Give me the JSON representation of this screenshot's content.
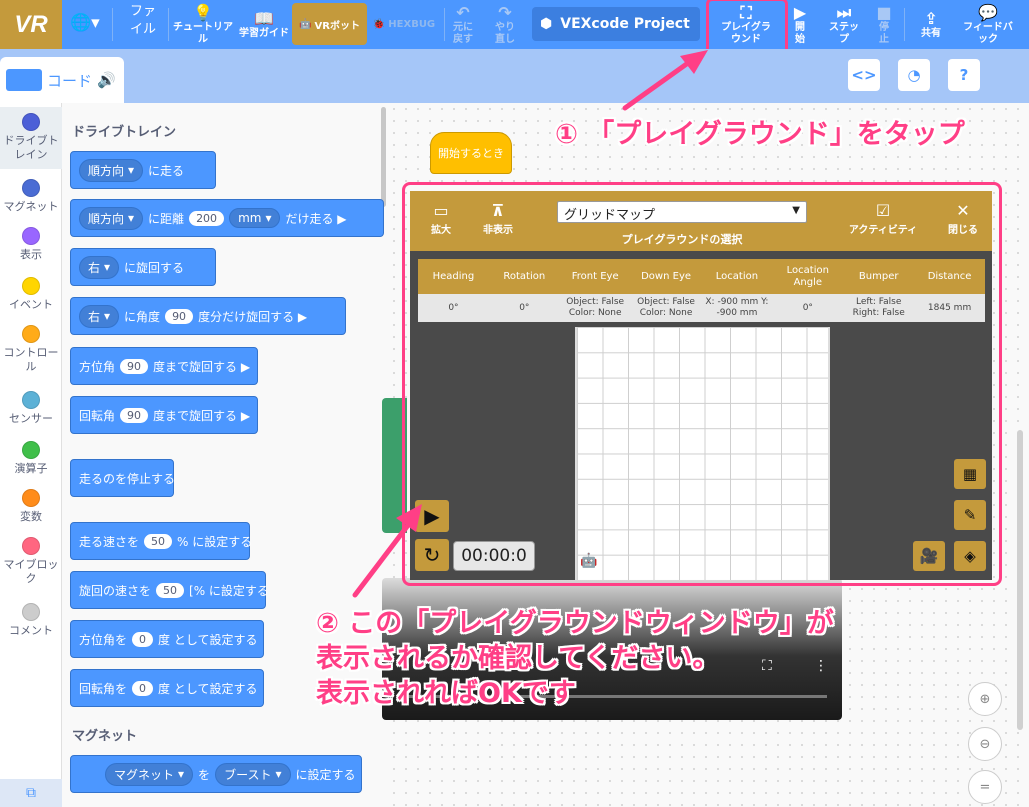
{
  "topbar": {
    "logo": "VR",
    "file_menu": "ファイル",
    "tutorial": "チュートリアル",
    "learning_guide": "学習ガイド",
    "vr_robot": "VRボット",
    "hexbug": "HEXBUG",
    "undo": "元に戻す",
    "redo": "やり直し",
    "project_name": "VEXcode Project",
    "playground": "プレイグラウンド",
    "start": "開始",
    "step": "ステップ",
    "stop": "停止",
    "share": "共有",
    "feedback": "フィードバック"
  },
  "subbar": {
    "code_tab": "コード"
  },
  "categories": [
    {
      "label": "ドライブトレイン",
      "color": "#4c5fd7"
    },
    {
      "label": "マグネット",
      "color": "#4a6cd4"
    },
    {
      "label": "表示",
      "color": "#9966ff"
    },
    {
      "label": "イベント",
      "color": "#ffd500"
    },
    {
      "label": "コントロール",
      "color": "#ffab19"
    },
    {
      "label": "センサー",
      "color": "#5cb1d6"
    },
    {
      "label": "演算子",
      "color": "#40bf4a"
    },
    {
      "label": "変数",
      "color": "#ff8c1a"
    },
    {
      "label": "マイブロック",
      "color": "#ff6680"
    },
    {
      "label": "コメント",
      "color": "#cccccc"
    }
  ],
  "palette": {
    "section_drivetrain": "ドライブトレイン",
    "section_magnet": "マグネット",
    "b1_dd": "順方向",
    "b1_text": "に走る",
    "b2_dd": "順方向",
    "b2_text": "に距離",
    "b2_num": "200",
    "b2_unit": "mm",
    "b2_tail": "だけ走る ▶",
    "b3_dd": "右",
    "b3_text": "に旋回する",
    "b4_dd": "右",
    "b4_text": "に角度",
    "b4_num": "90",
    "b4_tail": "度分だけ旋回する ▶",
    "b5_head": "方位角",
    "b5_num": "90",
    "b5_tail": "度まで旋回する ▶",
    "b6_head": "回転角",
    "b6_num": "90",
    "b6_tail": "度まで旋回する ▶",
    "b7_text": "走るのを停止する",
    "b8_head": "走る速さを",
    "b8_num": "50",
    "b8_tail": "% に設定する",
    "b9_head": "旋回の速さを",
    "b9_num": "50",
    "b9_tail": "[% に設定する",
    "b10_head": "方位角を",
    "b10_num": "0",
    "b10_tail": "度 として設定する",
    "b11_head": "回転角を",
    "b11_num": "0",
    "b11_tail": "度 として設定する",
    "b12_dd1": "マグネット",
    "b12_mid": "を",
    "b12_dd2": "ブースト",
    "b12_tail": "に設定する"
  },
  "workspace": {
    "hat_block": "開始するとき"
  },
  "playground_window": {
    "expand": "拡大",
    "hide": "非表示",
    "select_value": "グリッドマップ",
    "select_label": "プレイグラウンドの選択",
    "activity": "アクティビティ",
    "close": "閉じる",
    "headers": [
      "Heading",
      "Rotation",
      "Front Eye",
      "Down Eye",
      "Location",
      "Location Angle",
      "Bumper",
      "Distance"
    ],
    "values": [
      "0°",
      "0°",
      "Object: False Color: None",
      "Object: False Color: None",
      "X: -900 mm Y: -900 mm",
      "0°",
      "Left: False Right: False",
      "1845 mm"
    ],
    "timer": "00:00:0"
  },
  "annotations": {
    "step1": "① 「プレイグラウンド」をタップ",
    "step2_line1": "② この「プレイグラウンドウィンドウ」が",
    "step2_line2": "表示されるか確認してください。",
    "step2_line3": "表示されればOKです"
  },
  "colors": {
    "topbar": "#4c97ff",
    "accent_gold": "#c49a3c",
    "annotation": "#ff3f86",
    "motion_block": "#4c97ff"
  }
}
